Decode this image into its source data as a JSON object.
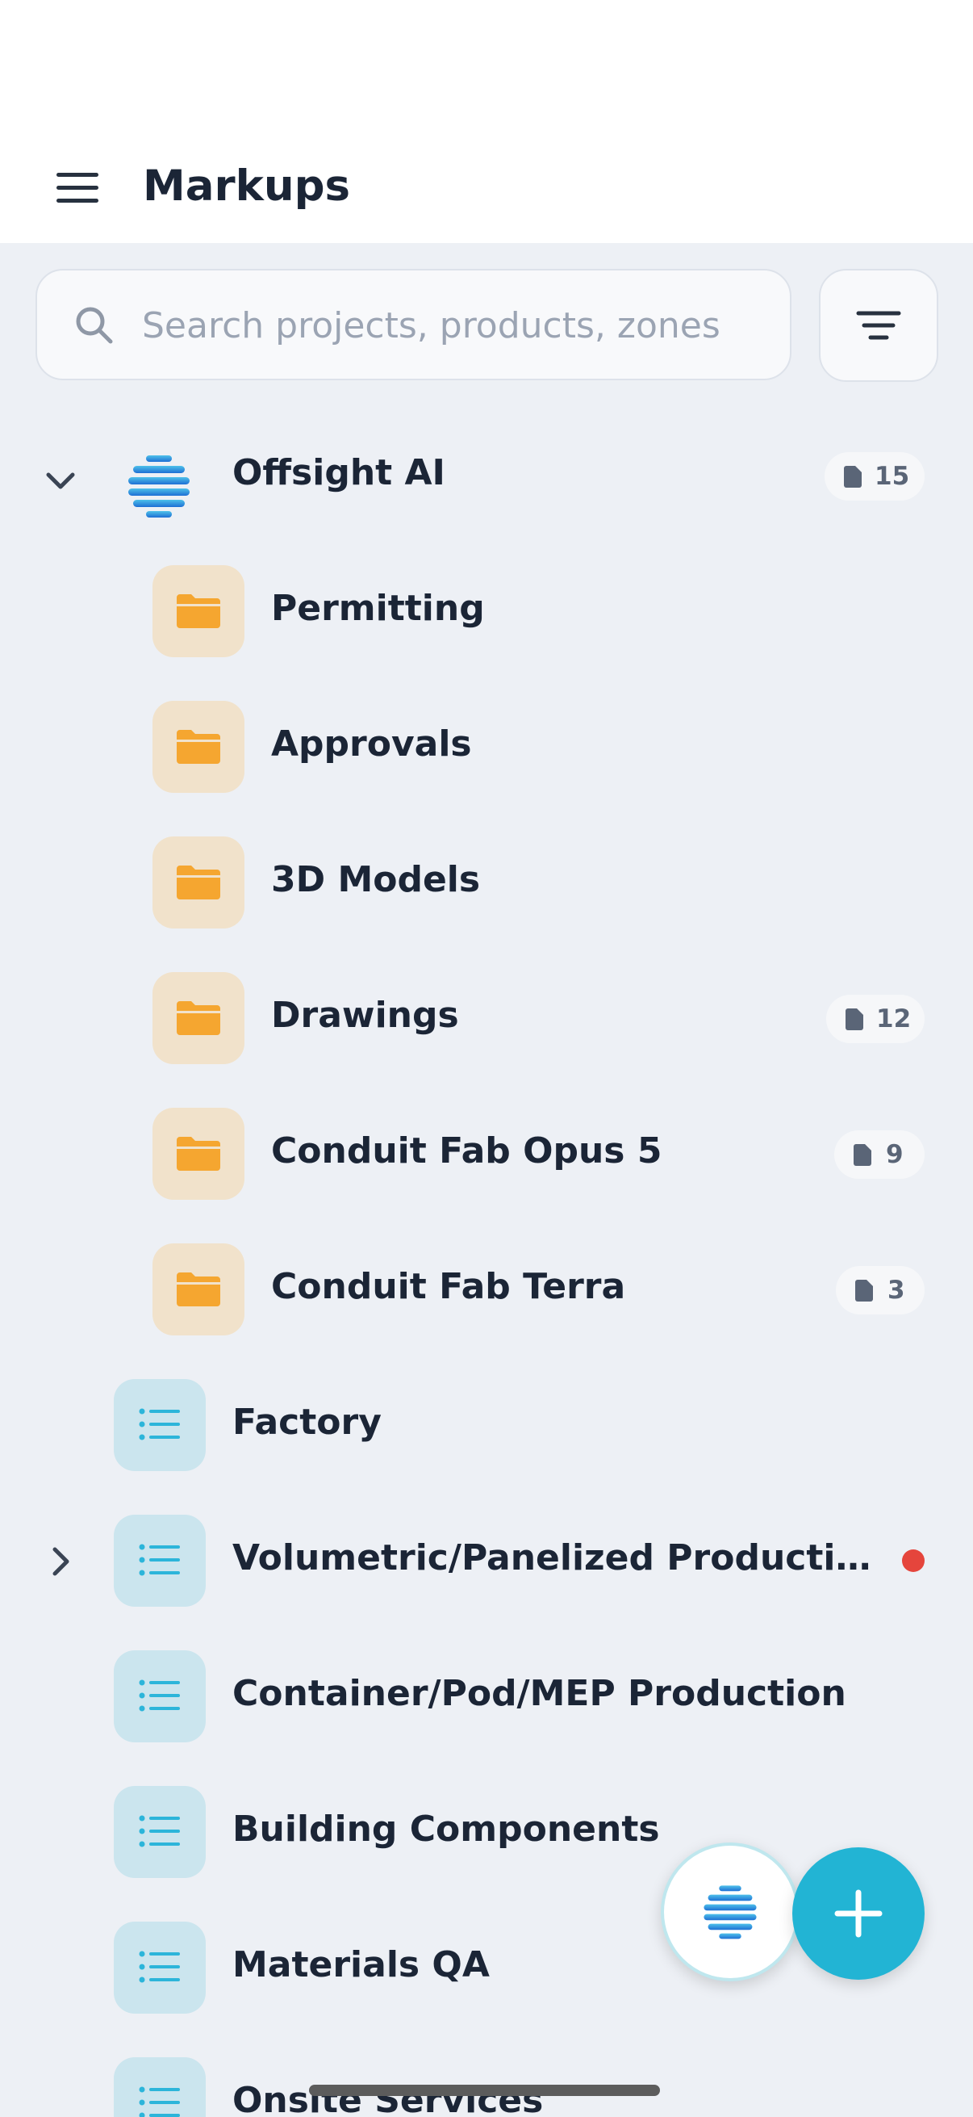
{
  "header": {
    "title": "Markups"
  },
  "search": {
    "placeholder": "Search projects, products, zones"
  },
  "tree": {
    "root": {
      "label": "Offsight AI",
      "count": "15"
    },
    "folders": [
      {
        "label": "Permitting",
        "count": ""
      },
      {
        "label": "Approvals",
        "count": ""
      },
      {
        "label": "3D Models",
        "count": ""
      },
      {
        "label": "Drawings",
        "count": "12"
      },
      {
        "label": "Conduit Fab Opus 5",
        "count": "9"
      },
      {
        "label": "Conduit Fab Terra",
        "count": "3"
      }
    ],
    "lists": [
      {
        "label": "Factory"
      },
      {
        "label": "Volumetric/Panelized Producti…",
        "has_notification": true
      },
      {
        "label": "Container/Pod/MEP Production"
      },
      {
        "label": "Building Components"
      },
      {
        "label": "Materials QA"
      },
      {
        "label": "Onsite Services"
      }
    ]
  },
  "colors": {
    "accent": "#22B4D4",
    "folder_icon": "#F5A630",
    "folder_tile": "#F1E2CB",
    "list_icon": "#2CB5DA",
    "list_tile": "#CBE5EE",
    "notification": "#E5453C"
  },
  "icons": {
    "menu": "hamburger-icon",
    "search": "search-icon",
    "filter": "filter-icon",
    "expand": "chevron-down-icon",
    "collapse": "chevron-right-icon",
    "folder": "folder-icon",
    "list": "list-icon",
    "document": "document-icon",
    "brand": "offsight-logo-icon",
    "add": "plus-icon"
  }
}
